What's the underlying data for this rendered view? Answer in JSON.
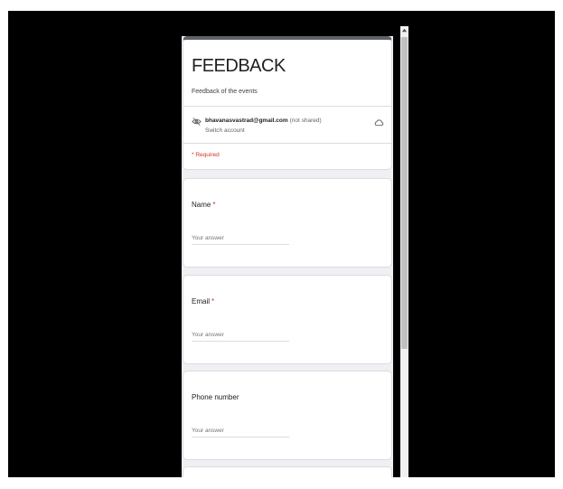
{
  "form": {
    "title": "FEEDBACK",
    "description": "Feedback of the events",
    "account_email": "bhavanasvastrad@gmail.com",
    "account_note": "(not shared)",
    "switch_account": "Switch account",
    "required_note": "* Required"
  },
  "questions": [
    {
      "label": "Name",
      "required": "*",
      "placeholder": "Your answer"
    },
    {
      "label": "Email",
      "required": "*",
      "placeholder": "Your answer"
    },
    {
      "label": "Phone number",
      "required": "",
      "placeholder": "Your answer"
    }
  ],
  "icons": {
    "account": "eye-off-icon",
    "cloud": "cloud-icon"
  },
  "colors": {
    "background": "#000000",
    "form_background": "#eef0f3",
    "header_accent": "#5f6368",
    "required": "#d93025"
  }
}
